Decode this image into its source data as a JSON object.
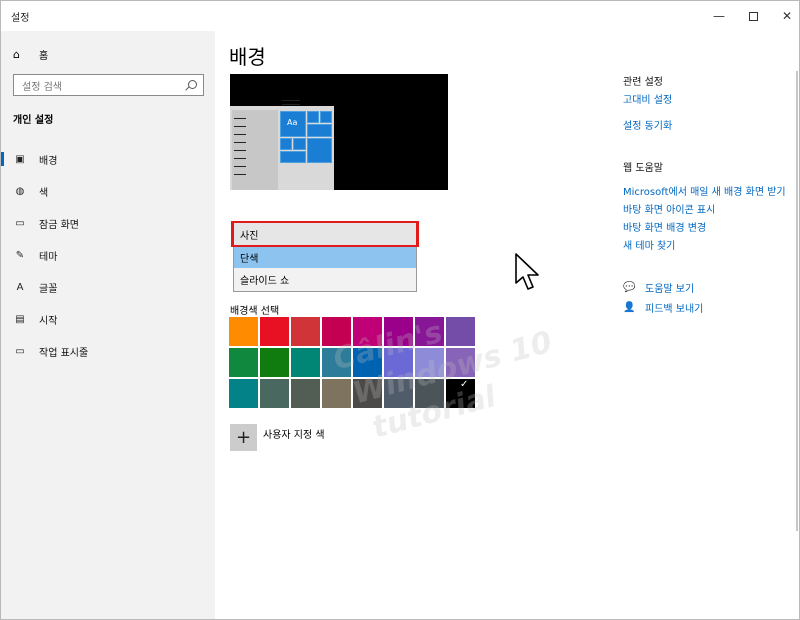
{
  "window": {
    "title": "설정"
  },
  "sidebar": {
    "home_label": "홈",
    "search_placeholder": "설정 검색",
    "section_title": "개인 설정",
    "items": [
      {
        "label": "배경",
        "icon": "image-icon",
        "active": true
      },
      {
        "label": "색",
        "icon": "palette-icon"
      },
      {
        "label": "잠금 화면",
        "icon": "lock-screen-icon"
      },
      {
        "label": "테마",
        "icon": "theme-icon"
      },
      {
        "label": "글꼴",
        "icon": "font-icon"
      },
      {
        "label": "시작",
        "icon": "start-icon"
      },
      {
        "label": "작업 표시줄",
        "icon": "taskbar-icon"
      }
    ]
  },
  "main": {
    "title": "배경",
    "preview_text": "Aa",
    "dropdown": {
      "options": [
        "사진",
        "단색",
        "슬라이드 쇼"
      ],
      "highlighted": "사진",
      "selected": "단색"
    },
    "colors_label": "배경색 선택",
    "swatches": [
      "#ff8c00",
      "#e81123",
      "#d13438",
      "#c30052",
      "#bf0077",
      "#9a0089",
      "#881798",
      "#744da9",
      "#10893e",
      "#107c10",
      "#018574",
      "#2d7d9a",
      "#0063b1",
      "#6b69d6",
      "#8e8cd8",
      "#8764b8",
      "#038387",
      "#486860",
      "#525e54",
      "#7e735f",
      "#4c4a48",
      "#515c6b",
      "#4a5459",
      "#000000"
    ],
    "checked_color": "#000000",
    "custom_color_label": "사용자 지정 색"
  },
  "right": {
    "related_heading": "관련 설정",
    "related_links": [
      "고대비 설정",
      "설정 동기화"
    ],
    "web_help_heading": "웹 도움말",
    "web_links": [
      "Microsoft에서 매일 새 배경 화면 받기",
      "바탕 화면 아이콘 표시",
      "바탕 화면 배경 변경",
      "새 테마 찾기"
    ],
    "help_label": "도움말 보기",
    "feedback_label": "피드백 보내기"
  },
  "watermark": [
    "Câlin's",
    "Windows 10",
    "tutorial"
  ]
}
